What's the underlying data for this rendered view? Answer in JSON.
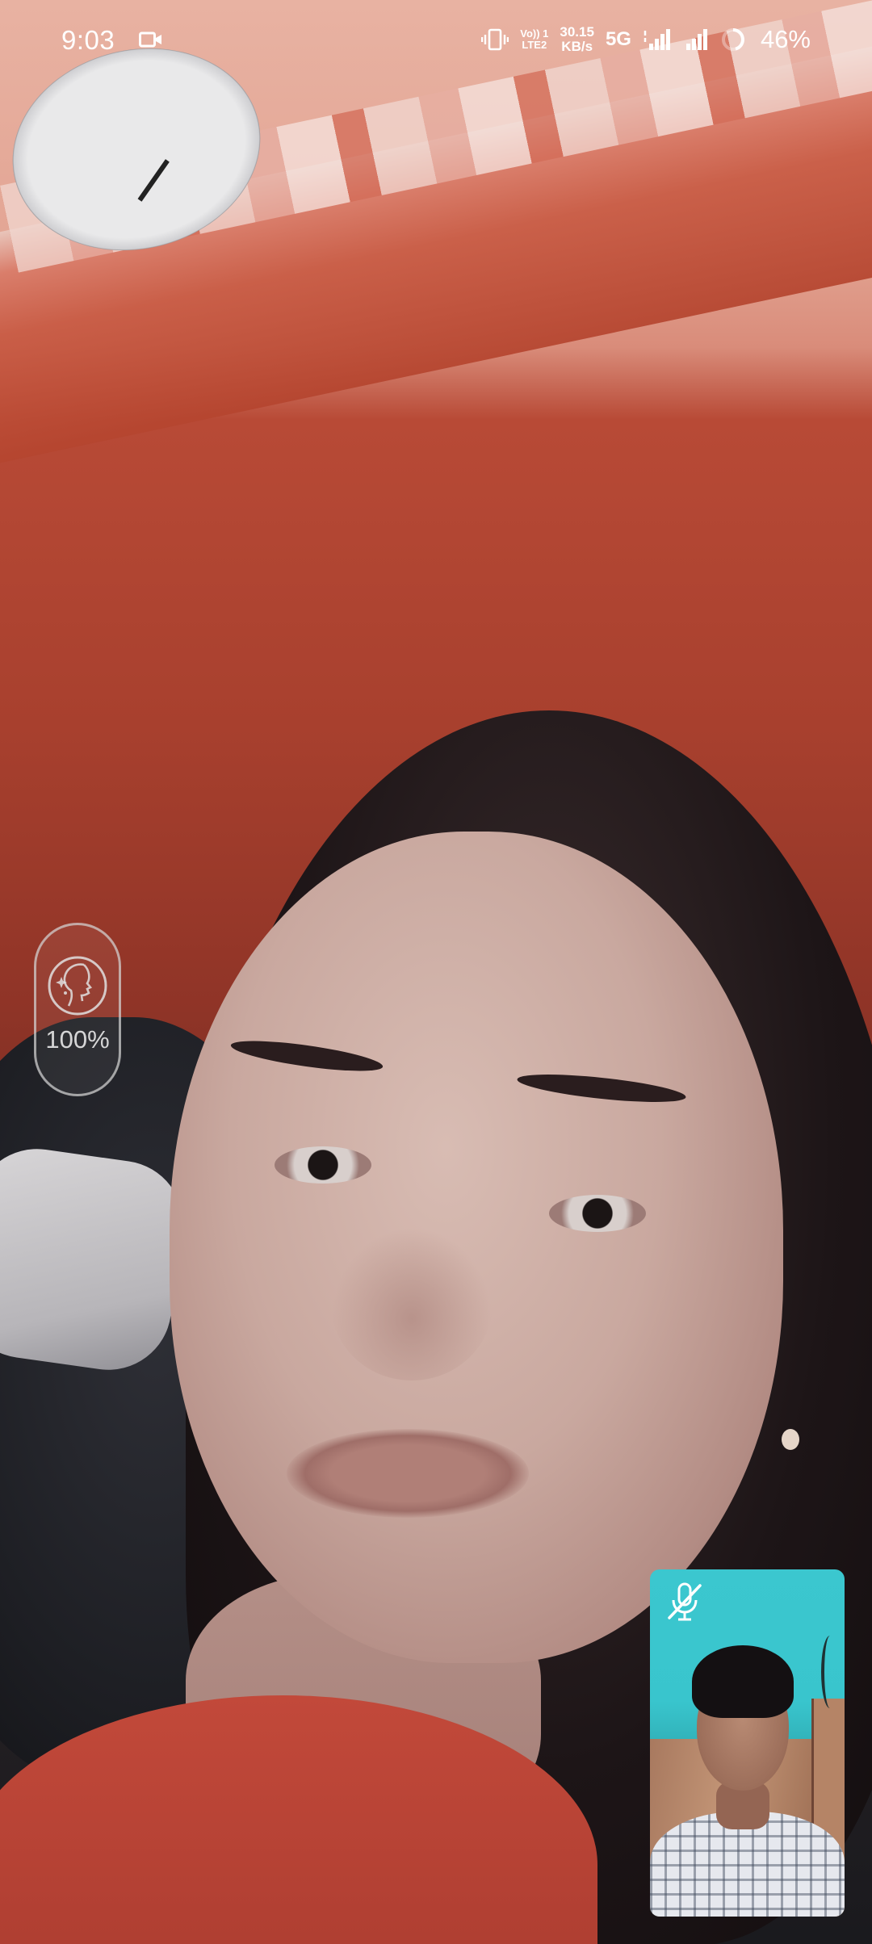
{
  "status_bar": {
    "time": "9:03",
    "volte_top": "Vo)) 1",
    "volte_bottom": "LTE2",
    "speed_value": "30.15",
    "speed_unit": "KB/s",
    "network_type": "5G",
    "battery_percent": "46%",
    "icons": [
      "video-camera-icon",
      "vibrate-icon",
      "signal-icon",
      "battery-ring-icon"
    ]
  },
  "beauty_filter": {
    "icon": "face-beauty-icon",
    "level": "100%"
  },
  "self_preview": {
    "icon": "mic-off-icon",
    "accent": "#3bc7cf"
  }
}
